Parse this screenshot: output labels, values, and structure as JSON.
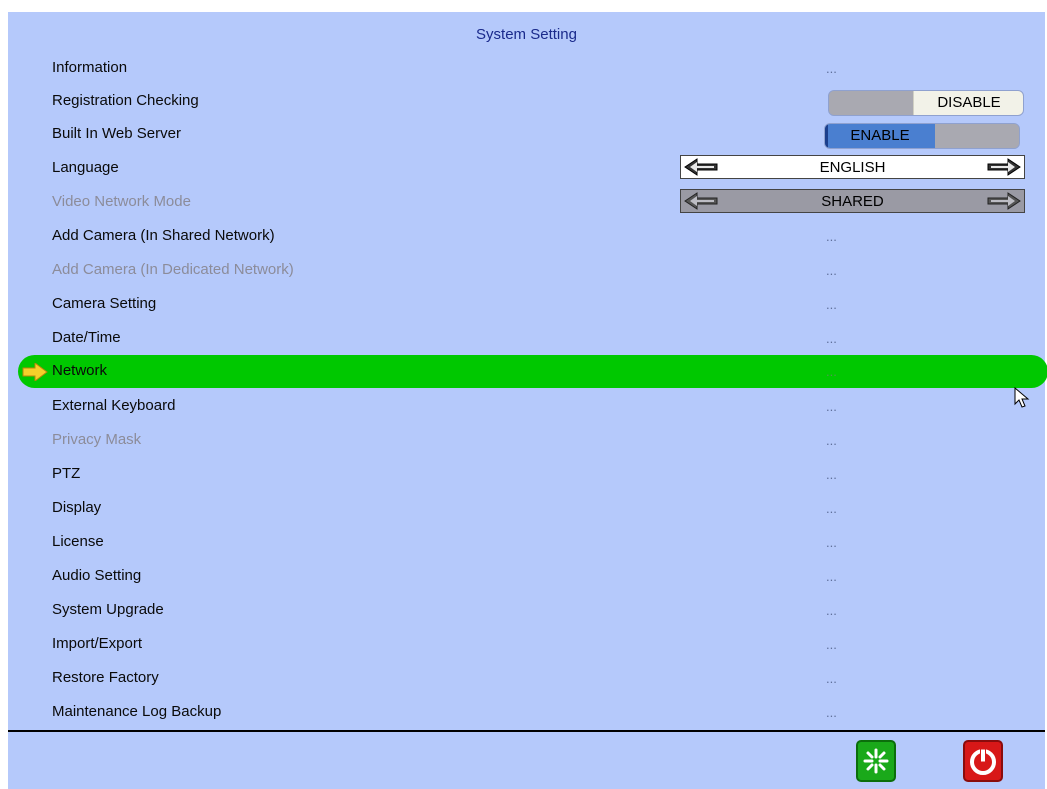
{
  "title": "System Setting",
  "rows": [
    {
      "label": "Information",
      "value": "...",
      "disabled": false
    },
    {
      "label": "Registration Checking",
      "disabled": false,
      "toggle": "DISABLE"
    },
    {
      "label": "Built In Web Server",
      "disabled": false,
      "toggle": "ENABLE"
    },
    {
      "label": "Language",
      "disabled": false,
      "selector": "ENGLISH"
    },
    {
      "label": "Video Network Mode",
      "disabled": true,
      "selector": "SHARED"
    },
    {
      "label": "Add Camera (In Shared Network)",
      "value": "...",
      "disabled": false
    },
    {
      "label": "Add Camera (In Dedicated Network)",
      "value": "...",
      "disabled": true
    },
    {
      "label": "Camera Setting",
      "value": "...",
      "disabled": false
    },
    {
      "label": "Date/Time",
      "value": "...",
      "disabled": false
    },
    {
      "label": "Network",
      "value": "...",
      "disabled": false,
      "selected": true
    },
    {
      "label": "External Keyboard",
      "value": "...",
      "disabled": false
    },
    {
      "label": "Privacy Mask",
      "value": "...",
      "disabled": true
    },
    {
      "label": "PTZ",
      "value": "...",
      "disabled": false
    },
    {
      "label": "Display",
      "value": "...",
      "disabled": false
    },
    {
      "label": "License",
      "value": "...",
      "disabled": false
    },
    {
      "label": "Audio Setting",
      "value": "...",
      "disabled": false
    },
    {
      "label": "System Upgrade",
      "value": "...",
      "disabled": false
    },
    {
      "label": "Import/Export",
      "value": "...",
      "disabled": false
    },
    {
      "label": "Restore Factory",
      "value": "...",
      "disabled": false
    },
    {
      "label": "Maintenance Log Backup",
      "value": "...",
      "disabled": false
    }
  ],
  "footer": {
    "apply_icon": "apply-sparkle-icon",
    "exit_icon": "power-icon"
  },
  "colors": {
    "panel_bg": "#b5c9fb",
    "selected_row": "#00c800",
    "enable_toggle": "#4a7fd0",
    "apply_button": "#1aa91a",
    "exit_button": "#d81818"
  }
}
